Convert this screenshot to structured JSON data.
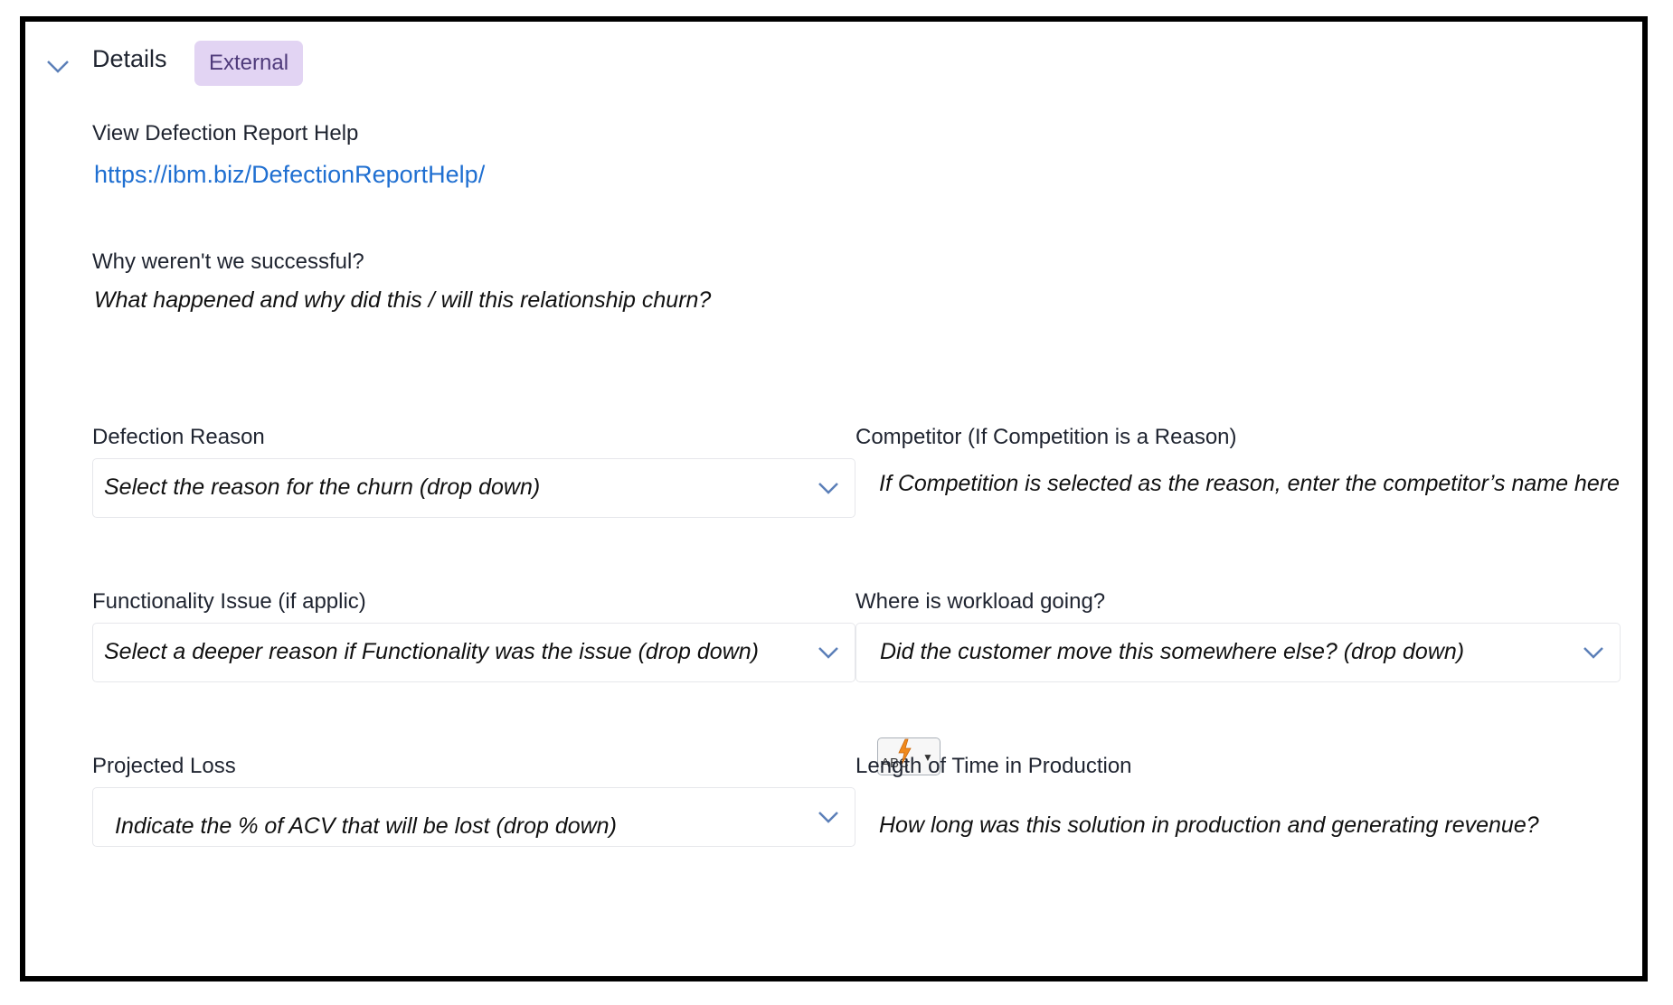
{
  "section": {
    "title": "Details",
    "badge": "External"
  },
  "help": {
    "label": "View Defection Report Help",
    "url": "https://ibm.biz/DefectionReportHelp/"
  },
  "why": {
    "label": "Why weren't we successful?",
    "value": "What happened and why did this / will this relationship churn?"
  },
  "fields": {
    "defection_reason": {
      "label": "Defection Reason",
      "placeholder": "Select the reason for the churn (drop down)"
    },
    "competitor": {
      "label": "Competitor (If Competition is a Reason)",
      "value": "If Competition is selected as the reason, enter the competitor’s name here"
    },
    "functionality": {
      "label": "Functionality Issue (if applic)",
      "placeholder": "Select a deeper reason if Functionality was the issue (drop down)"
    },
    "workload": {
      "label": "Where is workload going?",
      "placeholder": "Did the customer move this somewhere else? (drop down)"
    },
    "projected_loss": {
      "label": "Projected Loss",
      "placeholder": "Indicate the % of ACV that will be lost (drop down)"
    },
    "time_in_production": {
      "label": "Length of Time in Production",
      "value": "How long was this solution in production and generating revenue?"
    }
  },
  "spellcheck": {
    "text": "ABC"
  },
  "icons": {
    "section_toggle": "chevron-down-icon",
    "dropdown": "chevron-down-icon",
    "spellcheck": "lightning-icon"
  },
  "colors": {
    "badge_bg": "#e2d4f3",
    "badge_text": "#4e3a7a",
    "link": "#1f6fd1",
    "chevron": "#5b7fb8"
  }
}
